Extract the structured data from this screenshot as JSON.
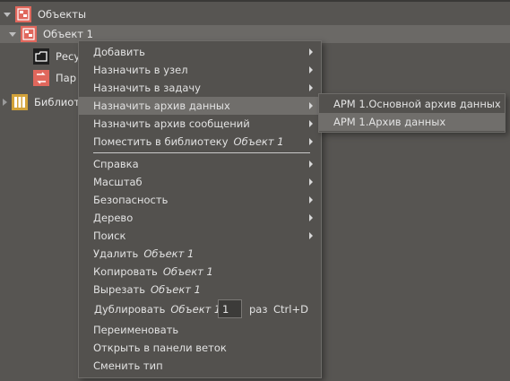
{
  "tree": {
    "root": {
      "label": "Объекты",
      "icon": "object-icon"
    },
    "object1": {
      "label": "Объект 1",
      "icon": "object-icon"
    },
    "child_resources": {
      "label": "Ресу",
      "icon": "folder-icon"
    },
    "child_params": {
      "label": "Пар",
      "icon": "params-icon"
    },
    "library": {
      "label": "Библиот",
      "icon": "library-icon"
    }
  },
  "context_menu": {
    "items": [
      {
        "label": "Добавить"
      },
      {
        "label": "Назначить в узел"
      },
      {
        "label": "Назначить в задачу"
      },
      {
        "label": "Назначить архив данных"
      },
      {
        "label": "Назначить архив сообщений"
      },
      {
        "label": "Поместить в библиотеку",
        "object": "Объект 1"
      },
      {
        "label": "Справка"
      },
      {
        "label": "Масштаб"
      },
      {
        "label": "Безопасность"
      },
      {
        "label": "Дерево"
      },
      {
        "label": "Поиск"
      },
      {
        "label": "Удалить",
        "object": "Объект 1"
      },
      {
        "label": "Копировать",
        "object": "Объект 1"
      },
      {
        "label": "Вырезать",
        "object": "Объект 1"
      },
      {
        "label": "Дублировать",
        "object": "Объект 1",
        "count": "1",
        "count_suffix": "раз",
        "shortcut": "Ctrl+D"
      },
      {
        "label": "Переименовать"
      },
      {
        "label": "Открыть в панели веток"
      },
      {
        "label": "Сменить тип"
      }
    ]
  },
  "submenu": {
    "items": [
      {
        "label": "АРМ 1.Основной архив данных"
      },
      {
        "label": "АРМ 1.Архив данных"
      }
    ]
  },
  "colors": {
    "background": "#575552",
    "menu": "#53514e",
    "highlight": "#706e6b",
    "icon_red": "#e0675c"
  }
}
